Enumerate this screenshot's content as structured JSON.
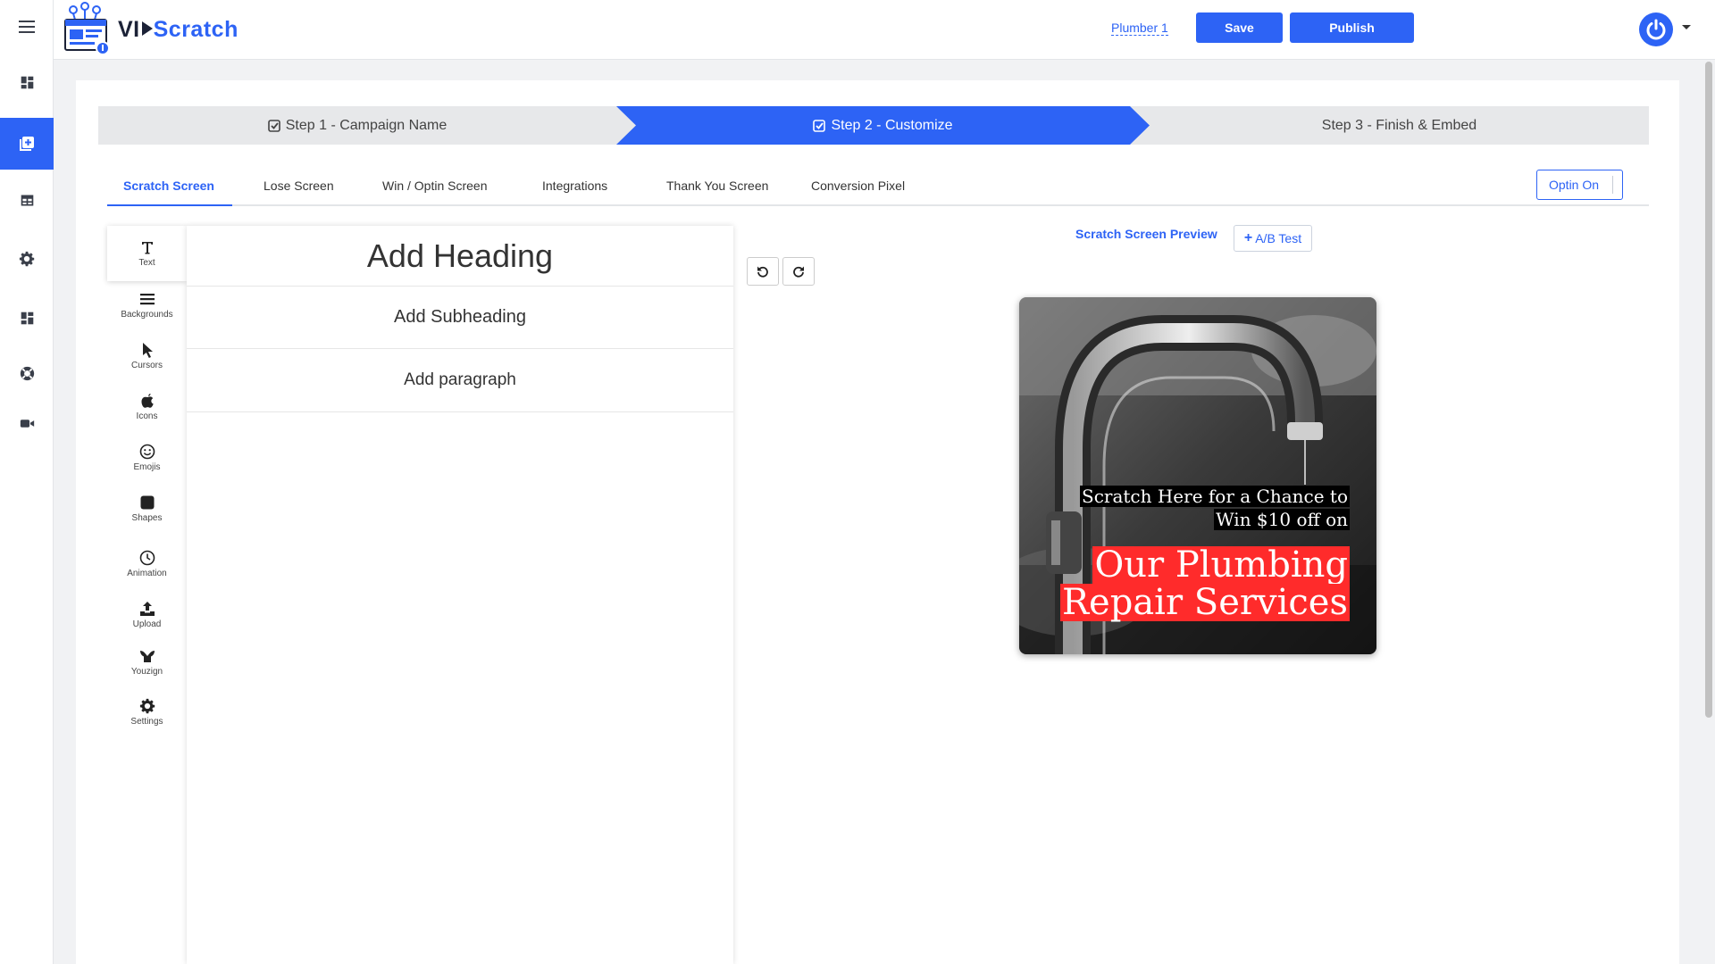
{
  "app": {
    "logo_vi": "VI",
    "logo_scratch": "Scratch"
  },
  "header": {
    "campaign_name": "Plumber 1",
    "save_label": "Save",
    "publish_label": "Publish"
  },
  "rail_icons": [
    "menu-icon",
    "dashboard-icon",
    "add-campaign-icon",
    "table-icon",
    "settings-icon",
    "apps-icon",
    "support-icon",
    "video-icon"
  ],
  "steps": [
    {
      "label": "Step 1 - Campaign Name",
      "checked": true
    },
    {
      "label": "Step 2 - Customize",
      "checked": true,
      "active": true
    },
    {
      "label": "Step 3 - Finish & Embed",
      "checked": false
    }
  ],
  "tabs": [
    "Scratch Screen",
    "Lose Screen",
    "Win / Optin Screen",
    "Integrations",
    "Thank You Screen",
    "Conversion Pixel"
  ],
  "optin_label": "Optin On",
  "tools": [
    "Text",
    "Backgrounds",
    "Cursors",
    "Icons",
    "Emojis",
    "Shapes",
    "Animation",
    "Upload",
    "Youzign",
    "Settings"
  ],
  "text_panel": {
    "heading": "Add Heading",
    "subheading": "Add Subheading",
    "paragraph": "Add paragraph"
  },
  "preview": {
    "title": "Scratch Screen Preview",
    "ab_test_label": "A/B Test",
    "line1": "Scratch Here for a Chance to",
    "line2": "Win $10 off on",
    "big1": "Our Plumbing",
    "big2": "Repair Services"
  },
  "colors": {
    "accent": "#2d63f5",
    "highlight_red": "#ff2b2b"
  }
}
